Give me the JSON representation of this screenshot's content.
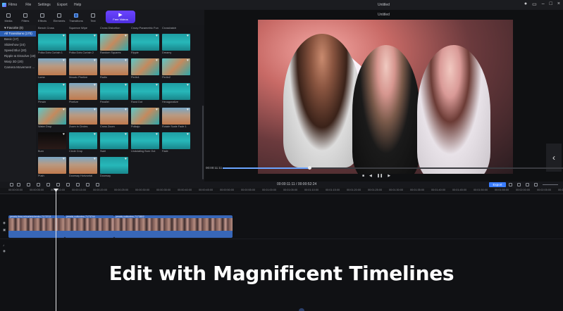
{
  "app": {
    "name": "Filmo",
    "menu": [
      "File",
      "Settings",
      "Export",
      "Help"
    ],
    "window_title": "Untitled"
  },
  "toolbar": {
    "tools": [
      "Media",
      "Filters",
      "Effects",
      "Elements",
      "Transitions",
      "Text",
      "Audio"
    ],
    "active": "Transitions",
    "new_video": "Free Videos"
  },
  "sidebar": {
    "items": [
      {
        "label": "♥ Favorite (0)",
        "state": "fav"
      },
      {
        "label": "All Transitions (170)",
        "state": "sel"
      },
      {
        "label": "Basic (17)",
        "state": ""
      },
      {
        "label": "Slideshow (24)",
        "state": ""
      },
      {
        "label": "Speed Blur (20)",
        "state": ""
      },
      {
        "label": "Ripple & Dissolve (19)",
        "state": ""
      },
      {
        "label": "Warp 3D (20)",
        "state": ""
      },
      {
        "label": "Camera Movement ...",
        "state": ""
      }
    ]
  },
  "grid": {
    "header_labels": [
      "Bench Cross",
      "Squeeze Wipe",
      "Cross Distortion",
      "Crazy Parametric Fun",
      "Crosshatch"
    ],
    "tiles": [
      {
        "label": "Polka Dots Curtain 1",
        "style": "t-c"
      },
      {
        "label": "Polka Dots Curtain 2",
        "style": "t-c"
      },
      {
        "label": "Random Squares",
        "style": "t-m"
      },
      {
        "label": "Ripple",
        "style": "t-c"
      },
      {
        "label": "Dreamy",
        "style": "t-c"
      },
      {
        "label": "Luma",
        "style": "t-d"
      },
      {
        "label": "Mosaic Pixelize",
        "style": "t-d"
      },
      {
        "label": "Radio",
        "style": "t-d"
      },
      {
        "label": "Perlin1",
        "style": "t-m"
      },
      {
        "label": "Perlin2",
        "style": "t-m"
      },
      {
        "label": "Pinwin",
        "style": "t-c"
      },
      {
        "label": "Pixelize",
        "style": "t-d"
      },
      {
        "label": "Parallel",
        "style": "t-c"
      },
      {
        "label": "Rand Dot",
        "style": "t-c"
      },
      {
        "label": "Hexagonalize",
        "style": "t-c"
      },
      {
        "label": "Water Drop",
        "style": "t-m"
      },
      {
        "label": "Zoom in Circles",
        "style": "t-d"
      },
      {
        "label": "Cross Zoom",
        "style": "t-d"
      },
      {
        "label": "Polkajo",
        "style": "t-m"
      },
      {
        "label": "Rotate Scale Fade 1",
        "style": "t-d"
      },
      {
        "label": "Burn",
        "style": "t-b"
      },
      {
        "label": "Circle Crop",
        "style": "t-c"
      },
      {
        "label": "Swirl",
        "style": "t-c"
      },
      {
        "label": "Undulating Burn Out",
        "style": "t-c"
      },
      {
        "label": "Fade",
        "style": "t-c"
      },
      {
        "label": "Push",
        "style": "t-d"
      },
      {
        "label": "Doorway Horizontal",
        "style": "t-d"
      },
      {
        "label": "Doorway",
        "style": "t-c"
      }
    ]
  },
  "preview": {
    "time": "00:00:11:11",
    "progress": 0.25
  },
  "timeline": {
    "timecode": "00:00:11:11 / 00:00:52:24",
    "export_label": "Export",
    "ruler": [
      "00:00:00:00",
      "00:00:05:00",
      "00:00:10:00",
      "00:00:15:00",
      "00:00:20:00",
      "00:00:25:00",
      "00:00:30:00",
      "00:00:35:00",
      "00:00:40:00",
      "00:00:45:00",
      "00:00:50:00",
      "00:00:55:00",
      "00:01:00:00",
      "00:01:05:00",
      "00:01:10:00",
      "00:01:15:00",
      "00:01:20:00",
      "00:01:25:00",
      "00:01:30:00",
      "00:01:35:00",
      "00:01:40:00",
      "00:01:45:00",
      "00:01:50:00",
      "00:01:55:00",
      "00:02:00:00",
      "00:02:05:00",
      "00:02:10:00"
    ],
    "clips": [
      {
        "name": "pexels-tima-miroshnichenko-7173713"
      },
      {
        "name": "pexels-cottonbro-7173744"
      },
      {
        "name": "pexels-cottonbro-7173802"
      }
    ]
  },
  "overlay": {
    "title": "Edit with Magnificent Timelines"
  },
  "colors": {
    "accent": "#3a7dff",
    "clip": "#3867b8",
    "selected_sidebar": "#2b5fb5"
  }
}
